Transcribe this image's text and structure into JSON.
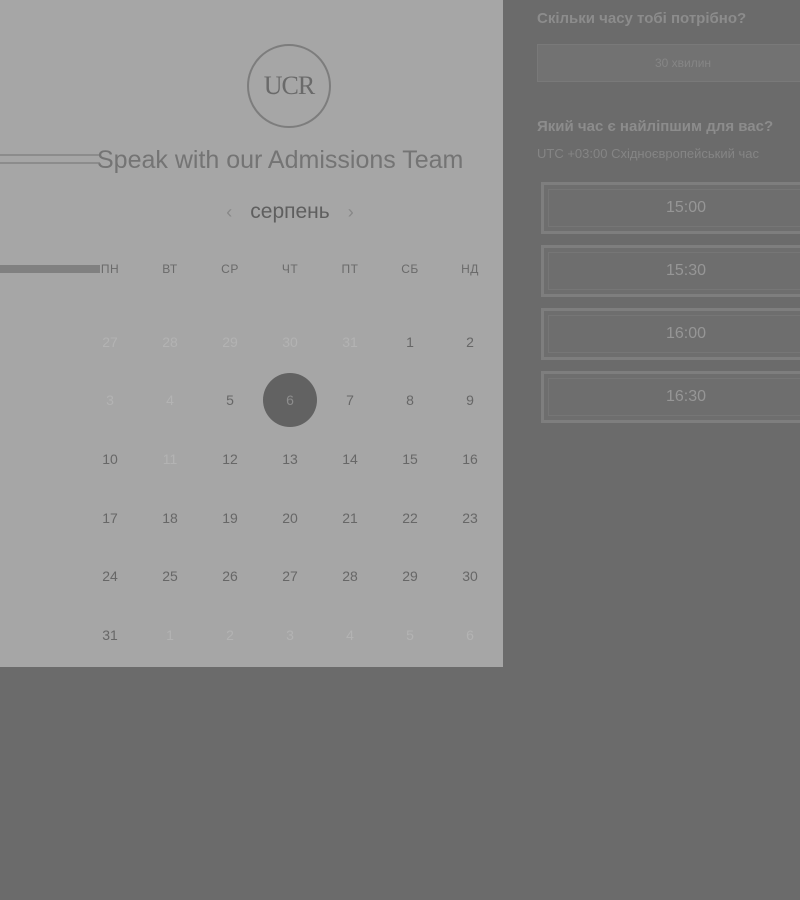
{
  "left": {
    "logo_text": "UCR",
    "title": "Speak with our Admissions Team",
    "month": "серпень",
    "prev_arrow": "‹",
    "next_arrow": "›",
    "weekdays": [
      "ПН",
      "ВТ",
      "СР",
      "ЧТ",
      "ПТ",
      "СБ",
      "НД"
    ],
    "weeks": [
      [
        "27",
        "28",
        "29",
        "30",
        "31",
        "1",
        "2"
      ],
      [
        "3",
        "4",
        "5",
        "6",
        "7",
        "8",
        "9"
      ],
      [
        "10",
        "11",
        "12",
        "13",
        "14",
        "15",
        "16"
      ],
      [
        "17",
        "18",
        "19",
        "20",
        "21",
        "22",
        "23"
      ],
      [
        "24",
        "25",
        "26",
        "27",
        "28",
        "29",
        "30"
      ],
      [
        "31",
        "1",
        "2",
        "3",
        "4",
        "5",
        "6"
      ]
    ],
    "selected_day": "6"
  },
  "right": {
    "duration_question": "Скільки часу тобі потрібно?",
    "duration_value": "30 хвилин",
    "time_question": "Який час є найліпшим для вас?",
    "timezone": "UTC +03:00 Східноєвропейський час",
    "slots": [
      "15:00",
      "15:30",
      "16:00",
      "16:30"
    ]
  }
}
